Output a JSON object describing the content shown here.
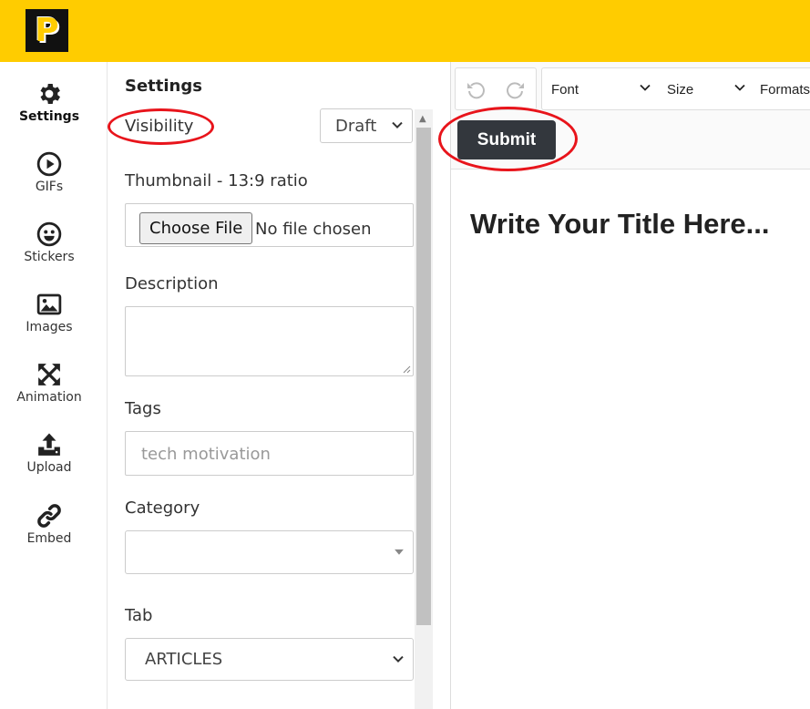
{
  "logo": {
    "letter": "P"
  },
  "nav": [
    {
      "label": "Settings",
      "icon": "gear-icon",
      "active": true
    },
    {
      "label": "GIFs",
      "icon": "play-circle-icon"
    },
    {
      "label": "Stickers",
      "icon": "smiley-icon"
    },
    {
      "label": "Images",
      "icon": "image-icon"
    },
    {
      "label": "Animation",
      "icon": "expand-arrows-icon"
    },
    {
      "label": "Upload",
      "icon": "upload-icon"
    },
    {
      "label": "Embed",
      "icon": "link-icon"
    }
  ],
  "settings": {
    "title": "Settings",
    "visibility_label": "Visibility",
    "visibility_value": "Draft",
    "thumbnail_label": "Thumbnail - 13:9 ratio",
    "choose_file_label": "Choose File",
    "no_file_text": "No file chosen",
    "description_label": "Description",
    "description_value": "",
    "tags_label": "Tags",
    "tags_placeholder": "tech motivation",
    "category_label": "Category",
    "category_value": "",
    "tab_label": "Tab",
    "tab_value": "ARTICLES"
  },
  "editor": {
    "font_label": "Font",
    "size_label": "Size",
    "formats_label": "Formats",
    "submit_label": "Submit",
    "title_placeholder": "Write Your Title Here..."
  },
  "colors": {
    "brand_yellow": "#ffcc00",
    "submit_bg": "#33373d",
    "annotation_red": "#e8141b"
  }
}
